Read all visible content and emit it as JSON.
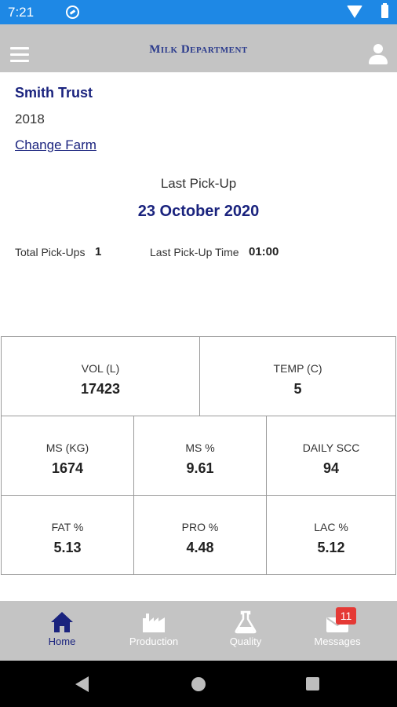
{
  "status_bar": {
    "time": "7:21"
  },
  "header": {
    "logo_text": "Milk Department"
  },
  "farm": {
    "name": "Smith Trust",
    "year": "2018",
    "change_link": "Change Farm"
  },
  "pickup": {
    "last_label": "Last Pick-Up",
    "last_date": "23 October 2020",
    "total_label": "Total Pick-Ups",
    "total_value": "1",
    "time_label": "Last Pick-Up Time",
    "time_value": "01:00"
  },
  "stats": {
    "vol": {
      "label": "VOL (L)",
      "value": "17423"
    },
    "temp": {
      "label": "TEMP (C)",
      "value": "5"
    },
    "ms_kg": {
      "label": "MS (KG)",
      "value": "1674"
    },
    "ms_pct": {
      "label": "MS %",
      "value": "9.61"
    },
    "daily_scc": {
      "label": "DAILY SCC",
      "value": "94"
    },
    "fat_pct": {
      "label": "FAT %",
      "value": "5.13"
    },
    "pro_pct": {
      "label": "PRO %",
      "value": "4.48"
    },
    "lac_pct": {
      "label": "LAC %",
      "value": "5.12"
    }
  },
  "bottom_nav": {
    "items": [
      {
        "label": "Home",
        "icon": "home-icon",
        "active": true
      },
      {
        "label": "Production",
        "icon": "factory-icon"
      },
      {
        "label": "Quality",
        "icon": "flask-icon"
      },
      {
        "label": "Messages",
        "icon": "envelope-icon"
      }
    ],
    "messages_badge": "11"
  },
  "colors": {
    "status_bar": "#1e88e5",
    "header": "#c4c4c4",
    "accent": "#1a237e",
    "badge": "#e53935"
  }
}
